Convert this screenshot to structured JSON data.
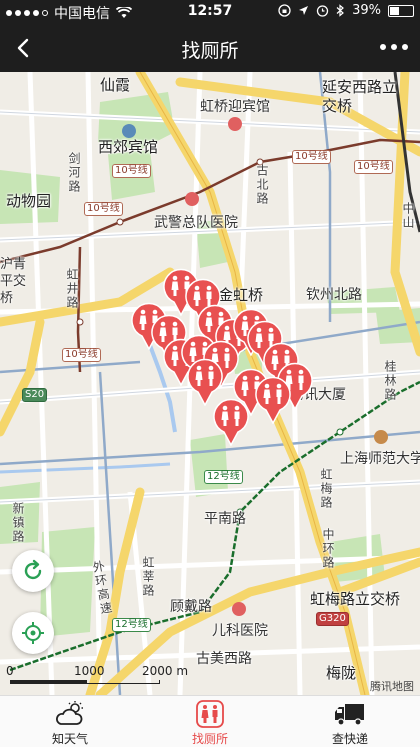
{
  "status_bar": {
    "carrier": "中国电信",
    "time": "12:57",
    "battery": "39%",
    "battery_level": 0.39
  },
  "nav": {
    "title": "找厕所"
  },
  "map": {
    "labels": {
      "xianxia": "仙霞",
      "hongqiao_guest": "虹桥迎宾馆",
      "yanan_bridge": "延安西路立交桥",
      "xijiao": "西郊宾馆",
      "zoo": "动物园",
      "hospital": "武警总队医院",
      "hugong": "沪青平交桥",
      "jinhongqiao": "金虹桥",
      "qinzhou": "钦州北路",
      "tencent": "腾讯大厦",
      "normal_univ": "上海师范大学",
      "pingnan": "平南路",
      "ring": "虹梅路立交桥",
      "ring_road": "中环路",
      "hongmei": "虹梅路",
      "meilong": "梅陇",
      "gudu": "顾戴路",
      "kids_hospital": "儿科医院",
      "gumei": "古美西路",
      "hongxin": "虹莘路",
      "xinzhen": "新镇路",
      "hongjing": "虹井路",
      "guibei": "桂林路",
      "gubei": "古北路",
      "wai_ring": "外环高速",
      "jianhe": "剑河路",
      "zhongshan": "中山"
    },
    "metro_lines": {
      "line10": "10号线",
      "line12": "12号线",
      "s20": "S20",
      "g320": "G320"
    },
    "scale": {
      "zero": "0",
      "mid": "1000",
      "max": "2000 m"
    },
    "credit": "腾讯地图"
  },
  "controls": {
    "refresh_icon": "refresh-icon",
    "locate_icon": "locate-icon"
  },
  "tabs": [
    {
      "label": "知天气",
      "icon": "weather-icon"
    },
    {
      "label": "找厕所",
      "icon": "toilet-icon",
      "active": true
    },
    {
      "label": "查快递",
      "icon": "truck-icon"
    }
  ],
  "colors": {
    "accent": "#e64a4a",
    "bar": "#1e1e1e",
    "pin": "#e85050"
  }
}
